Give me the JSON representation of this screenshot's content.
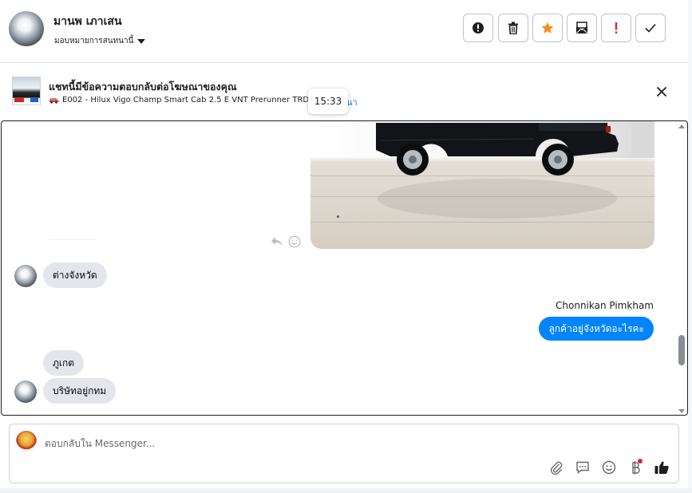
{
  "header": {
    "contact_name": "มานพ เภาเสน",
    "assign_label": "มอบหมายการสนทนานี้"
  },
  "banner": {
    "title": "แชทนี้มีข้อความตอบกลับต่อโฆษณาของคุณ",
    "ad_name": "E002 - Hilux Vigo Champ Smart Cab 2.5 E VNT Prerunner TRD Sp",
    "ad_link": "นา",
    "timestamp_tooltip": "15:33"
  },
  "messages": [
    {
      "from": "contact",
      "text": "ต่างจังหวัด"
    },
    {
      "from": "page",
      "sender": "Chonnikan Pimkham",
      "text": "ลูกค้าอยู่จังหวัดอะไรคะ"
    },
    {
      "from": "contact",
      "text": "ภูเกต"
    },
    {
      "from": "contact",
      "text": "บริษัทอยู่กทม"
    }
  ],
  "composer": {
    "placeholder": "ตอบกลับใน Messenger..."
  },
  "colors": {
    "accent": "#0084ff",
    "incoming_bubble": "#e4e6eb",
    "star": "#f58b1f",
    "alert": "#e41e3f"
  }
}
